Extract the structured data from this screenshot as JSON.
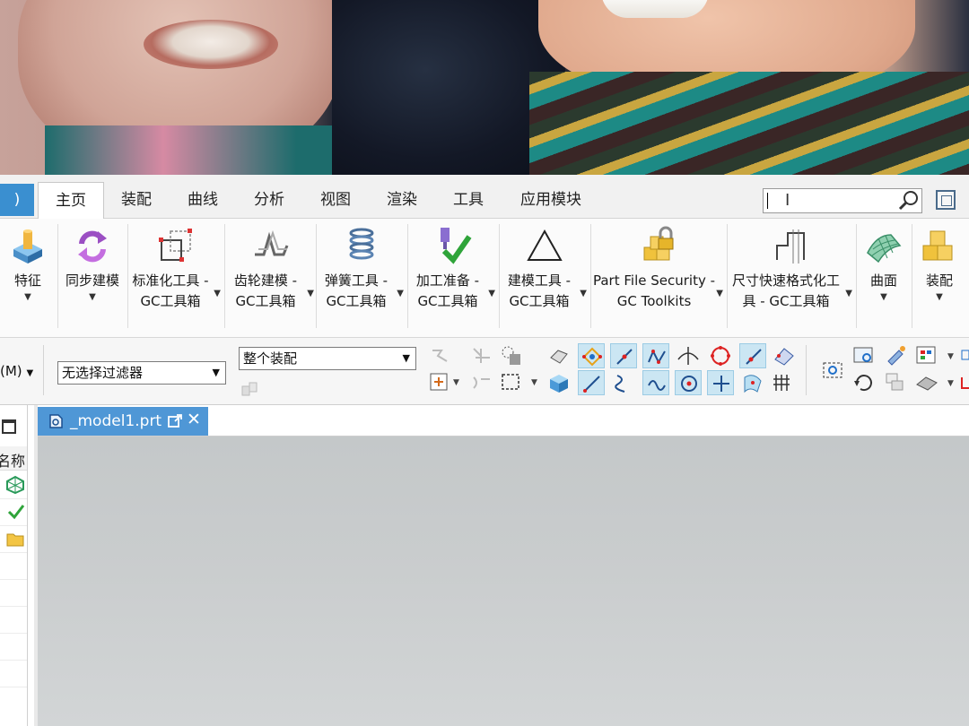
{
  "tabs": {
    "edge_label": ")",
    "items": [
      "主页",
      "装配",
      "曲线",
      "分析",
      "视图",
      "渲染",
      "工具",
      "应用模块"
    ],
    "active": "主页"
  },
  "search": {
    "value": "",
    "placeholder": ""
  },
  "ribbon": [
    {
      "label": "特征",
      "icon": "feature-icon"
    },
    {
      "label": "同步建模",
      "icon": "sync-modeling-icon"
    },
    {
      "label": "标准化工具 -\nGC工具箱",
      "icon": "standardization-tool-icon"
    },
    {
      "label": "齿轮建模 -\nGC工具箱",
      "icon": "gear-modeling-icon"
    },
    {
      "label": "弹簧工具 -\nGC工具箱",
      "icon": "spring-tool-icon"
    },
    {
      "label": "加工准备 -\nGC工具箱",
      "icon": "machining-prep-icon"
    },
    {
      "label": "建模工具 -\nGC工具箱",
      "icon": "modeling-tool-icon"
    },
    {
      "label": "Part File Security -\nGC Toolkits",
      "icon": "part-file-security-icon"
    },
    {
      "label": "尺寸快速格式化工\n具 - GC工具箱",
      "icon": "dimension-format-icon"
    },
    {
      "label": "曲面",
      "icon": "surface-icon"
    },
    {
      "label": "装配",
      "icon": "assembly-icon"
    }
  ],
  "toolbar": {
    "menu_label": "(M)",
    "selection_filter": "无选择过滤器",
    "assembly_scope": "整个装配"
  },
  "left_panel": {
    "header": "名称"
  },
  "document": {
    "tab_name": "_model1.prt"
  },
  "colors": {
    "accent": "#3a8fd0",
    "doc_tab": "#4f97d6",
    "viewport": "#c9cccd"
  }
}
